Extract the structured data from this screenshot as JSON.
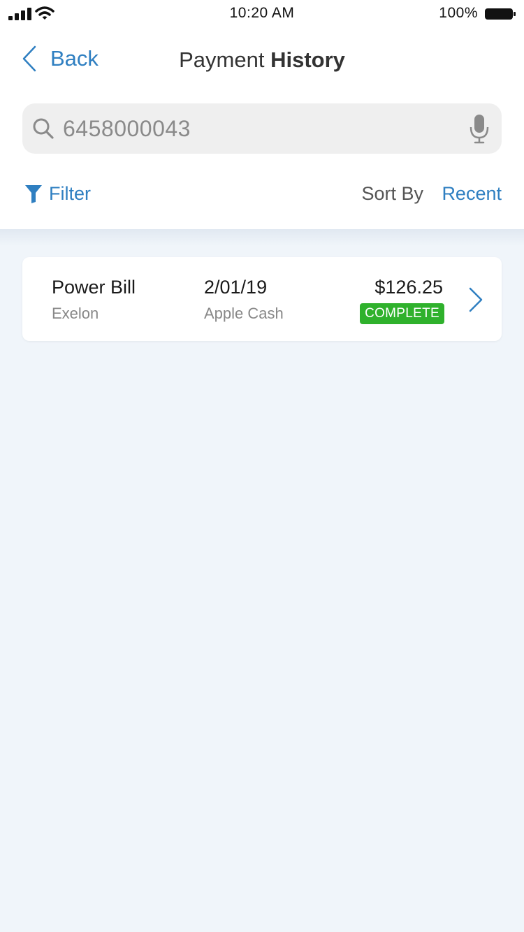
{
  "status_bar": {
    "time": "10:20 AM",
    "battery_percent": "100%",
    "icons": [
      "cellular-signal-icon",
      "wifi-icon",
      "battery-icon"
    ]
  },
  "header": {
    "back_label": "Back",
    "title_light": "Payment",
    "title_bold": "History"
  },
  "search": {
    "value": "6458000043",
    "icons": [
      "search-icon",
      "microphone-icon"
    ]
  },
  "toolbar": {
    "filter_label": "Filter",
    "sort_by_label": "Sort By",
    "sort_value": "Recent"
  },
  "payments": [
    {
      "name": "Power Bill",
      "payee": "Exelon",
      "date": "2/01/19",
      "method": "Apple Cash",
      "amount": "$126.25",
      "status": "COMPLETE"
    }
  ],
  "colors": {
    "accent": "#2f7fc1",
    "status_complete": "#2fb12c",
    "background": "#f0f5fa",
    "search_bg": "#efefef"
  }
}
